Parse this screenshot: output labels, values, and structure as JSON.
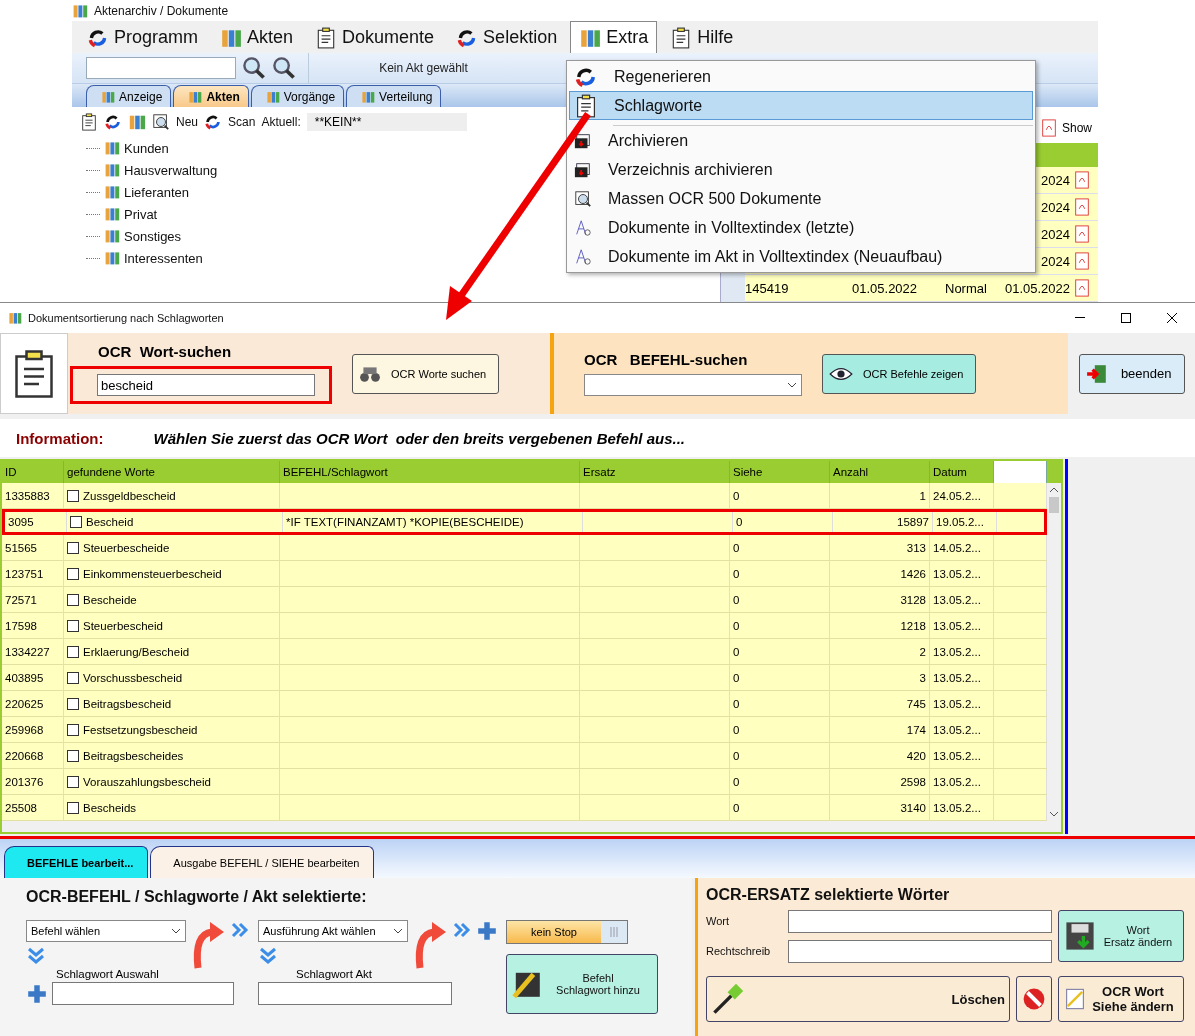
{
  "app_window": {
    "title": "Aktenarchiv / Dokumente",
    "menu": [
      {
        "label": "Programm",
        "selected": false
      },
      {
        "label": "Akten",
        "selected": false
      },
      {
        "label": "Dokumente",
        "selected": false
      },
      {
        "label": "Selektion",
        "selected": false
      },
      {
        "label": "Extra",
        "selected": true
      },
      {
        "label": "Hilfe",
        "selected": false
      }
    ],
    "toolbar_status": "Kein Akt gewählt",
    "tabs": [
      {
        "label": "Anzeige",
        "selected": false
      },
      {
        "label": "Akten",
        "selected": true
      },
      {
        "label": "Vorgänge",
        "selected": false
      },
      {
        "label": "Verteilung",
        "selected": false
      }
    ],
    "tools": {
      "new": "Neu",
      "scan": "Scan",
      "current_label": "Aktuell:",
      "current_value": "**KEIN**"
    },
    "tree": [
      {
        "label": "Kunden"
      },
      {
        "label": "Hausverwaltung"
      },
      {
        "label": "Lieferanten"
      },
      {
        "label": "Privat"
      },
      {
        "label": "Sonstiges"
      },
      {
        "label": "Interessenten"
      }
    ],
    "show_button": "Show",
    "rows": [
      {
        "cells": [
          "",
          "",
          "",
          "",
          "2024"
        ]
      },
      {
        "cells": [
          "",
          "",
          "",
          "",
          "2024"
        ]
      },
      {
        "cells": [
          "",
          "",
          "",
          "",
          "2024"
        ]
      },
      {
        "cells": [
          "",
          "",
          "",
          "",
          "2024"
        ]
      },
      {
        "cells": [
          "145419",
          "",
          "01.05.2022",
          "Normal",
          "01.05.2022"
        ]
      }
    ]
  },
  "extra_menu": [
    {
      "label": "Regenerieren",
      "selected": false
    },
    {
      "label": "Schlagworte",
      "selected": true
    },
    {
      "label": "Archivieren",
      "selected": false
    },
    {
      "label": "Verzeichnis archivieren",
      "selected": false
    },
    {
      "label": "Massen OCR 500 Dokumente",
      "selected": false
    },
    {
      "label": "Dokumente in Volltextindex (letzte)",
      "selected": false
    },
    {
      "label": "Dokumente im Akt in Volltextindex (Neuaufbau)",
      "selected": false
    }
  ],
  "dialog": {
    "title": "Dokumentsortierung nach Schlagworten",
    "word_search": {
      "label_1": "OCR",
      "label_2": "Wort-suchen",
      "value": "bescheid",
      "button": "OCR Worte suchen"
    },
    "command_search": {
      "label_1": "OCR",
      "label_2": "BEFEHL-suchen",
      "button": "OCR Befehle zeigen"
    },
    "close_button": "beenden",
    "info_label": "Information:",
    "info_text": "Wählen Sie zuerst das OCR Wort  oder den breits vergebenen Befehl aus...",
    "columns": [
      "ID",
      "gefundene Worte",
      "BEFEHL/Schlagwort",
      "Ersatz",
      "Siehe",
      "Anzahl",
      "Datum"
    ],
    "rows": [
      {
        "id": "1335883",
        "word": "Zussgeldbescheid",
        "command": "",
        "replacement": "",
        "see": "0",
        "count": "1",
        "date": "24.05.2...",
        "checked": false,
        "selected": false
      },
      {
        "id": "3095",
        "word": "Bescheid",
        "command": "*IF TEXT(FINANZAMT) *KOPIE(BESCHEIDE)",
        "replacement": "",
        "see": "0",
        "count": "15897",
        "date": "19.05.2...",
        "checked": false,
        "selected": true
      },
      {
        "id": "51565",
        "word": "Steuerbescheide",
        "command": "",
        "replacement": "",
        "see": "0",
        "count": "313",
        "date": "14.05.2...",
        "checked": false,
        "selected": false
      },
      {
        "id": "123751",
        "word": "Einkommensteuerbescheid",
        "command": "",
        "replacement": "",
        "see": "0",
        "count": "1426",
        "date": "13.05.2...",
        "checked": false,
        "selected": false
      },
      {
        "id": "72571",
        "word": "Bescheide",
        "command": "",
        "replacement": "",
        "see": "0",
        "count": "3128",
        "date": "13.05.2...",
        "checked": false,
        "selected": false
      },
      {
        "id": "17598",
        "word": "Steuerbescheid",
        "command": "",
        "replacement": "",
        "see": "0",
        "count": "1218",
        "date": "13.05.2...",
        "checked": false,
        "selected": false
      },
      {
        "id": "1334227",
        "word": "Erklaerung/Bescheid",
        "command": "",
        "replacement": "",
        "see": "0",
        "count": "2",
        "date": "13.05.2...",
        "checked": false,
        "selected": false
      },
      {
        "id": "403895",
        "word": "Vorschussbescheid",
        "command": "",
        "replacement": "",
        "see": "0",
        "count": "3",
        "date": "13.05.2...",
        "checked": false,
        "selected": false
      },
      {
        "id": "220625",
        "word": "Beitragsbescheid",
        "command": "",
        "replacement": "",
        "see": "0",
        "count": "745",
        "date": "13.05.2...",
        "checked": false,
        "selected": false
      },
      {
        "id": "259968",
        "word": "Festsetzungsbescheid",
        "command": "",
        "replacement": "",
        "see": "0",
        "count": "174",
        "date": "13.05.2...",
        "checked": false,
        "selected": false
      },
      {
        "id": "220668",
        "word": "Beitragsbescheides",
        "command": "",
        "replacement": "",
        "see": "0",
        "count": "420",
        "date": "13.05.2...",
        "checked": false,
        "selected": false
      },
      {
        "id": "201376",
        "word": "Vorauszahlungsbescheid",
        "command": "",
        "replacement": "",
        "see": "0",
        "count": "2598",
        "date": "13.05.2...",
        "checked": false,
        "selected": false
      },
      {
        "id": "25508",
        "word": "Bescheids",
        "command": "",
        "replacement": "",
        "see": "0",
        "count": "3140",
        "date": "13.05.2...",
        "checked": false,
        "selected": false
      }
    ],
    "bottom_tabs": [
      {
        "label": "BEFEHLE bearbeit...",
        "selected": true
      },
      {
        "label": "Ausgabe BEFEHL  / SIEHE bearbeiten",
        "selected": false
      }
    ],
    "command_panel": {
      "heading": "OCR-BEFEHL / Schlagworte / Akt selektierte:",
      "command_select": "Befehl wählen",
      "execution_select": "Ausführung Akt wählen",
      "keyword_label": "Schlagwort Auswahl",
      "file_keyword_label": "Schlagwort Akt",
      "stop_toggle": "kein Stop",
      "add_button": [
        "Befehl",
        "Schlagwort hinzu"
      ]
    },
    "replace_panel": {
      "heading": "OCR-ERSATZ selektierte Wörter",
      "word_label": "Wort",
      "spelling_label": "Rechtschreib",
      "replace_button": [
        "Wort",
        "Ersatz ändern"
      ],
      "delete_button": "Löschen",
      "see_button": [
        "OCR Wort",
        "Siehe ändern"
      ]
    }
  }
}
